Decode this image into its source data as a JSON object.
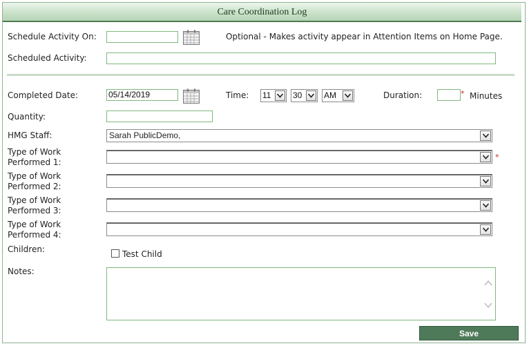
{
  "title": "Care Coordination Log",
  "schedule": {
    "label": "Schedule Activity On:",
    "date_value": "",
    "optional_note": "Optional - Makes activity appear in Attention Items on Home Page.",
    "activity_label": "Scheduled Activity:",
    "activity_value": ""
  },
  "completed": {
    "label": "Completed Date:",
    "date_value": "05/14/2019",
    "time_label": "Time:",
    "hour": "11",
    "minute": "30",
    "ampm": "AM",
    "duration_label": "Duration:",
    "duration_value": "",
    "required_mark": "*",
    "minutes_label": "Minutes"
  },
  "quantity": {
    "label": "Quantity:",
    "value": ""
  },
  "staff": {
    "label": "HMG Staff:",
    "value": "Sarah PublicDemo,"
  },
  "work": [
    {
      "label": "Type of Work Performed 1:",
      "value": "",
      "required_mark": "*"
    },
    {
      "label": "Type of Work Performed 2:",
      "value": ""
    },
    {
      "label": "Type of Work Performed 3:",
      "value": ""
    },
    {
      "label": "Type of Work Performed 4:",
      "value": ""
    }
  ],
  "children": {
    "label": "Children:",
    "child_name": "Test Child",
    "checked": false
  },
  "notes": {
    "label": "Notes:",
    "value": ""
  },
  "save_label": "Save",
  "colors": {
    "accent": "#4f7a5a",
    "input_border": "#7fb87f",
    "required": "#d62020"
  }
}
